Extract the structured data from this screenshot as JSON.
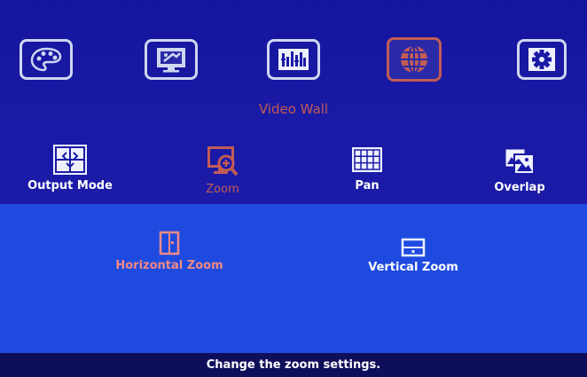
{
  "menu": {
    "tabs": [
      {
        "icon": "palette-icon",
        "active": false
      },
      {
        "icon": "display-settings-icon",
        "active": false
      },
      {
        "icon": "equalizer-icon",
        "active": false
      },
      {
        "icon": "globe-icon",
        "active": true
      },
      {
        "icon": "gear-icon",
        "active": false
      }
    ],
    "section_title": "Video Wall"
  },
  "submenu": {
    "items": [
      {
        "label": "Output Mode",
        "icon": "output-mode-icon",
        "active": false
      },
      {
        "label": "Zoom",
        "icon": "zoom-icon",
        "active": true
      },
      {
        "label": "Pan",
        "icon": "pan-grid-icon",
        "active": false
      },
      {
        "label": "Overlap",
        "icon": "overlap-icon",
        "active": false
      }
    ]
  },
  "zoom_options": [
    {
      "label": "Horizontal Zoom",
      "icon": "horizontal-zoom-icon",
      "active": true
    },
    {
      "label": "Vertical Zoom",
      "icon": "vertical-zoom-icon",
      "active": false
    }
  ],
  "status_bar": "Change the zoom settings.",
  "colors": {
    "accent": "#c25c55",
    "background": "#14149a",
    "panel": "#1f4ae0"
  }
}
